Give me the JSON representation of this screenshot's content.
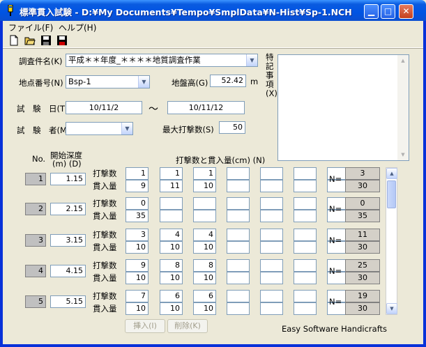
{
  "window": {
    "title": "標準貫入試験 - D:¥My Documents¥Tempo¥SmplData¥N-Hist¥Sp-1.NCH",
    "min_symbol": "▁",
    "max_symbol": "□",
    "close_symbol": "✕"
  },
  "menu": {
    "file": "ファイル(F)",
    "help": "ヘルプ(H)"
  },
  "toolbar": {
    "icons": [
      "new-file-icon",
      "open-folder-icon",
      "save-icon",
      "save-as-icon"
    ]
  },
  "form": {
    "survey_name_label": "調査件名(K)",
    "survey_name_value": "平成＊＊年度_＊＊＊＊地質調査作業",
    "point_no_label": "地点番号(N)",
    "point_no_value": "Bsp-1",
    "ground_height_label": "地盤高(G)",
    "ground_height_value": "52.42",
    "ground_height_unit": "m",
    "test_date_label": "試　験　日(T)",
    "test_date_from": "10/11/2",
    "test_date_tilde": "～",
    "test_date_to": "10/11/12",
    "tester_label": "試　験　者(M)",
    "tester_value": "",
    "max_blows_label": "最大打撃数(S)",
    "max_blows_value": "50",
    "memo_label": "特記事項(X)",
    "memo_value": ""
  },
  "grid": {
    "no_header": "No.",
    "depth_header_1": "開始深度",
    "depth_header_2": "(m)  (D)",
    "blows_header": "打撃数と貫入量(cm)  (N)",
    "row_label_blows": "打撃数",
    "row_label_pen": "貫入量",
    "n_label": "N=",
    "rows": [
      {
        "no": "1",
        "depth": "1.15",
        "blows": [
          "1",
          "1",
          "1",
          "",
          "",
          "",
          ""
        ],
        "pen": [
          "9",
          "11",
          "10",
          "",
          "",
          "",
          ""
        ],
        "n": "3",
        "total": "30"
      },
      {
        "no": "2",
        "depth": "2.15",
        "blows": [
          "0",
          "",
          "",
          "",
          "",
          "",
          ""
        ],
        "pen": [
          "35",
          "",
          "",
          "",
          "",
          "",
          ""
        ],
        "n": "0",
        "total": "35"
      },
      {
        "no": "3",
        "depth": "3.15",
        "blows": [
          "3",
          "4",
          "4",
          "",
          "",
          "",
          ""
        ],
        "pen": [
          "10",
          "10",
          "10",
          "",
          "",
          "",
          ""
        ],
        "n": "11",
        "total": "30"
      },
      {
        "no": "4",
        "depth": "4.15",
        "blows": [
          "9",
          "8",
          "8",
          "",
          "",
          "",
          ""
        ],
        "pen": [
          "10",
          "10",
          "10",
          "",
          "",
          "",
          ""
        ],
        "n": "25",
        "total": "30"
      },
      {
        "no": "5",
        "depth": "5.15",
        "blows": [
          "7",
          "6",
          "6",
          "",
          "",
          "",
          ""
        ],
        "pen": [
          "10",
          "10",
          "10",
          "",
          "",
          "",
          ""
        ],
        "n": "19",
        "total": "30"
      }
    ],
    "scroll_up": "▲",
    "scroll_down": "▼"
  },
  "buttons": {
    "insert": "挿入(I)",
    "delete": "削除(K)"
  },
  "footer": {
    "credit": "Easy  Software  Handicrafts"
  },
  "colors": {
    "titlebar": "#0054e3",
    "frame": "#0831d9",
    "face": "#ece9d8"
  }
}
